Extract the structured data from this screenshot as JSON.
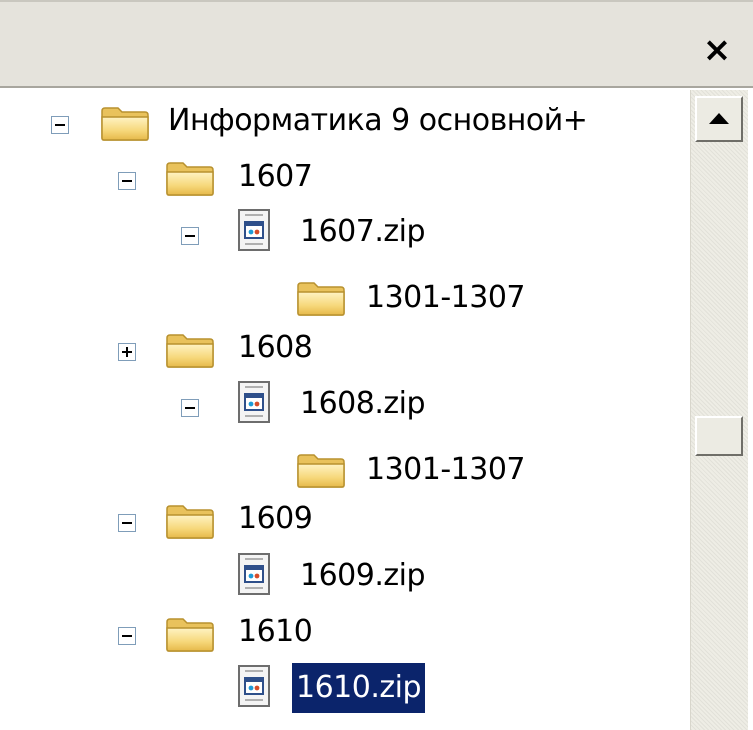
{
  "window": {
    "close_glyph": "×"
  },
  "tree": {
    "root": {
      "label": "Информатика  9 основной+",
      "expanded": true,
      "icon": "folder-icon"
    },
    "nodes": [
      {
        "label": "1607",
        "icon": "folder-icon",
        "toggle": "minus"
      },
      {
        "label": "1607.zip",
        "icon": "zip-file-icon",
        "toggle": "minus"
      },
      {
        "label": "1301-1307",
        "icon": "folder-icon",
        "toggle": "none"
      },
      {
        "label": "1608",
        "icon": "folder-icon",
        "toggle": "plus"
      },
      {
        "label": "1608.zip",
        "icon": "zip-file-icon",
        "toggle": "minus"
      },
      {
        "label": "1301-1307",
        "icon": "folder-icon",
        "toggle": "none"
      },
      {
        "label": "1609",
        "icon": "folder-icon",
        "toggle": "minus"
      },
      {
        "label": "1609.zip",
        "icon": "zip-file-icon",
        "toggle": "none"
      },
      {
        "label": "1610",
        "icon": "folder-icon",
        "toggle": "minus"
      },
      {
        "label": "1610.zip",
        "icon": "zip-file-icon",
        "toggle": "none",
        "selected": true
      }
    ]
  },
  "colors": {
    "selection_bg": "#0b246b",
    "selection_fg": "#ffffff",
    "titlebar_bg": "#e5e3dc"
  }
}
